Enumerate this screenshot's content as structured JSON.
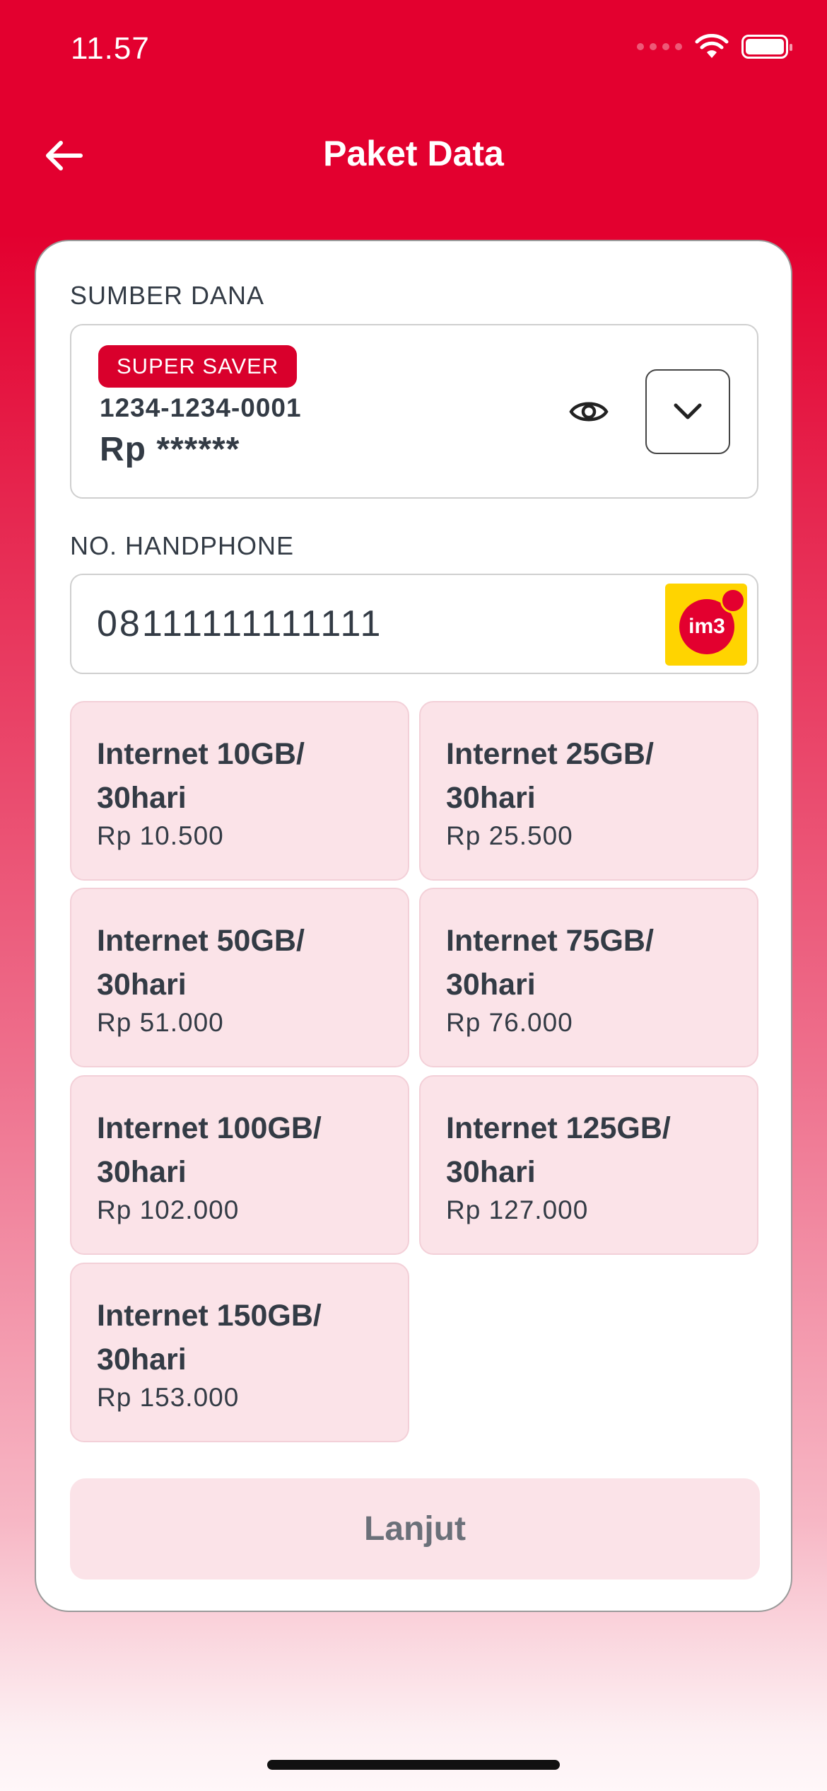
{
  "status_bar": {
    "time": "11.57",
    "wifi_icon": "wifi-icon",
    "battery_icon": "battery-icon"
  },
  "header": {
    "back_icon": "arrow-left-icon",
    "title": "Paket Data"
  },
  "funding": {
    "label": "SUMBER DANA",
    "badge": "SUPER SAVER",
    "account_number": "1234-1234-0001",
    "balance": "Rp ******",
    "eye_icon": "eye-icon",
    "dropdown_icon": "chevron-down-icon"
  },
  "phone": {
    "label": "NO. HANDPHONE",
    "value": "08111111111111",
    "operator_logo_text": "im3"
  },
  "packages": [
    {
      "name": "Internet 10GB/ 30hari",
      "price": "Rp 10.500"
    },
    {
      "name": "Internet 25GB/ 30hari",
      "price": "Rp 25.500"
    },
    {
      "name": "Internet 50GB/ 30hari",
      "price": "Rp 51.000"
    },
    {
      "name": "Internet 75GB/ 30hari",
      "price": "Rp 76.000"
    },
    {
      "name": "Internet 100GB/ 30hari",
      "price": "Rp 102.000"
    },
    {
      "name": "Internet 125GB/ 30hari",
      "price": "Rp 127.000"
    },
    {
      "name": "Internet 150GB/ 30hari",
      "price": "Rp 153.000"
    }
  ],
  "submit": {
    "label": "Lanjut"
  },
  "colors": {
    "brand_red": "#E3002F",
    "package_bg": "#FBE3E8",
    "text_dark": "#333B45"
  }
}
